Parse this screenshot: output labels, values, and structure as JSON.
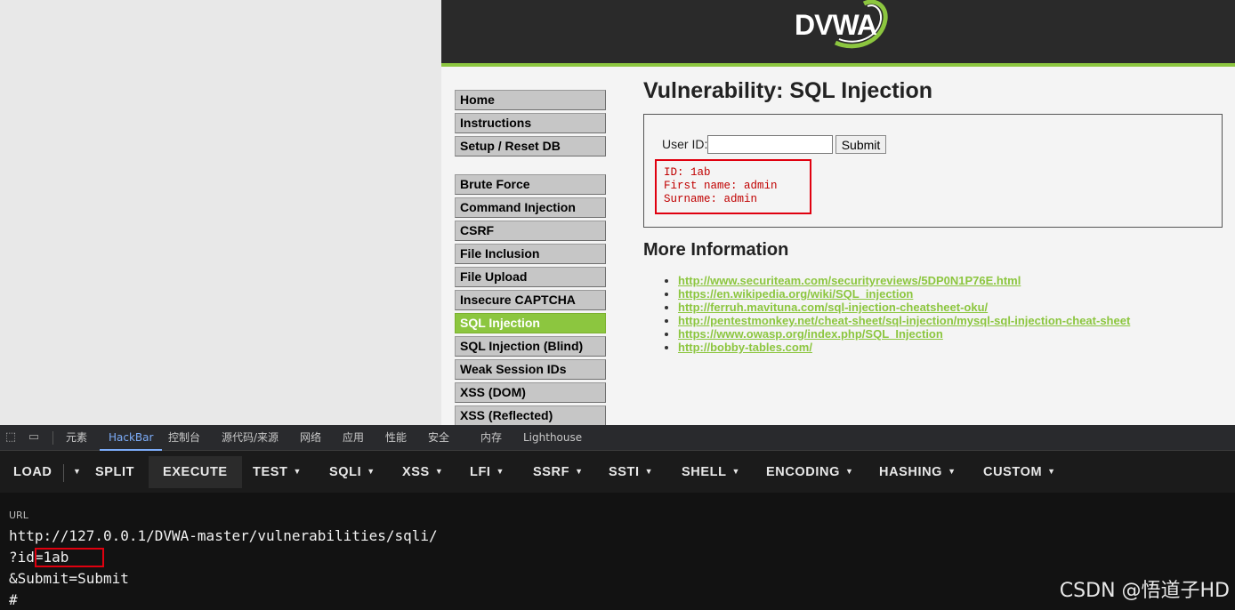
{
  "site": {
    "logo": "DVWA",
    "menu_top": [
      "Home",
      "Instructions",
      "Setup / Reset DB"
    ],
    "menu_vulns": [
      "Brute Force",
      "Command Injection",
      "CSRF",
      "File Inclusion",
      "File Upload",
      "Insecure CAPTCHA",
      "SQL Injection",
      "SQL Injection (Blind)",
      "Weak Session IDs",
      "XSS (DOM)",
      "XSS (Reflected)"
    ],
    "selected_menu": "SQL Injection",
    "title": "Vulnerability: SQL Injection",
    "form": {
      "userid_label": "User ID:",
      "userid_value": "",
      "submit_label": "Submit"
    },
    "result": [
      "ID: 1ab",
      "First name: admin",
      "Surname: admin"
    ],
    "more_info_title": "More Information",
    "links": [
      "http://www.securiteam.com/securityreviews/5DP0N1P76E.html",
      "https://en.wikipedia.org/wiki/SQL_injection",
      "http://ferruh.mavituna.com/sql-injection-cheatsheet-oku/",
      "http://pentestmonkey.net/cheat-sheet/sql-injection/mysql-sql-injection-cheat-sheet",
      "https://www.owasp.org/index.php/SQL_Injection",
      "http://bobby-tables.com/"
    ],
    "colors": {
      "accent": "#8cc63f",
      "header": "#2a2a2a",
      "highlight": "#e0000f"
    }
  },
  "devtools": {
    "tabs": [
      "元素",
      "HackBar",
      "控制台",
      "源代码/来源",
      "网络",
      "应用",
      "性能",
      "安全",
      "内存",
      "Lighthouse"
    ],
    "active_tab": "HackBar",
    "icons": [
      "inspect-icon",
      "device-toolbar-icon"
    ]
  },
  "hackbar": {
    "buttons": {
      "load": "LOAD",
      "split": "SPLIT",
      "execute": "EXECUTE",
      "test": "TEST",
      "sqli": "SQLI",
      "xss": "XSS",
      "lfi": "LFI",
      "ssrf": "SSRF",
      "ssti": "SSTI",
      "shell": "SHELL",
      "encoding": "ENCODING",
      "hashing": "HASHING",
      "custom": "CUSTOM"
    },
    "url_label": "URL",
    "url_lines": [
      "http://127.0.0.1/DVWA-master/vulnerabilities/sqli/",
      "?id=1ab",
      "&Submit=Submit",
      "#"
    ]
  },
  "watermark": "CSDN @悟道子HD"
}
